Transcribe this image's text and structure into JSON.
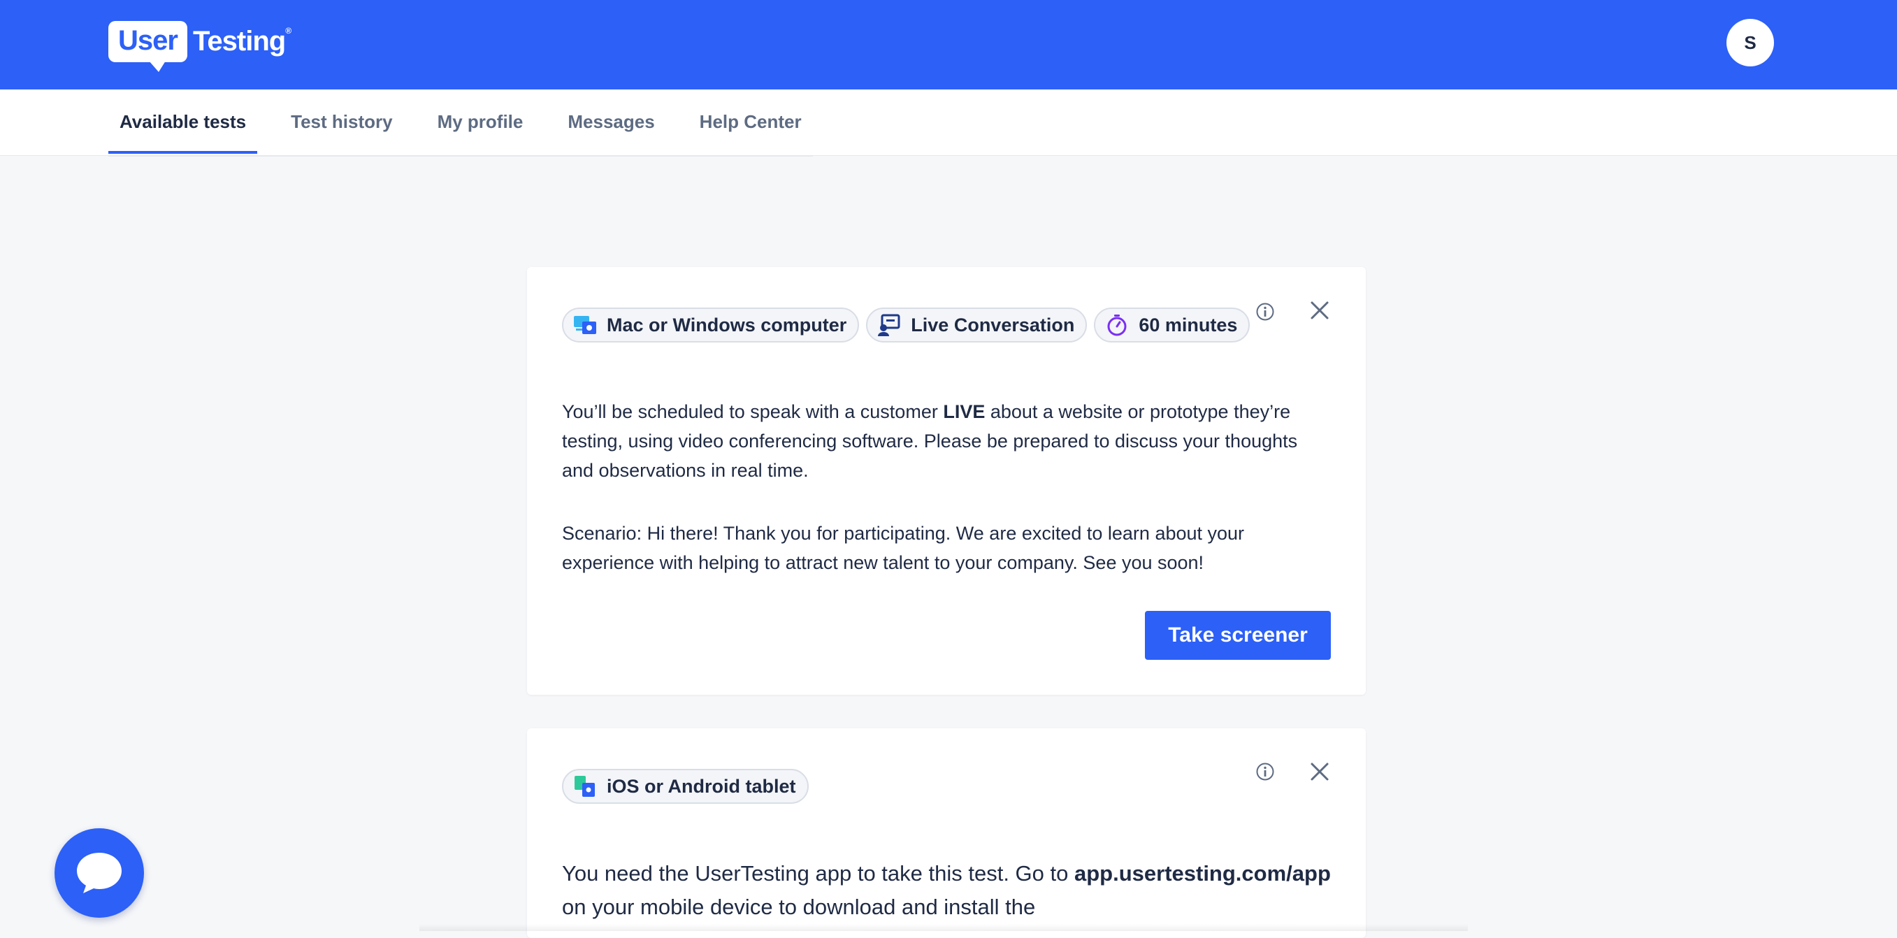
{
  "brand": {
    "logo_user": "User",
    "logo_testing": "Testing",
    "logo_reg": "®",
    "primary_color": "#2c60f7"
  },
  "account": {
    "avatar_initial": "S"
  },
  "nav": {
    "tabs": [
      {
        "label": "Available tests",
        "active": true
      },
      {
        "label": "Test history",
        "active": false
      },
      {
        "label": "My profile",
        "active": false
      },
      {
        "label": "Messages",
        "active": false
      },
      {
        "label": "Help Center",
        "active": false
      }
    ]
  },
  "tests": [
    {
      "tags": [
        {
          "icon": "desktop-devices-icon",
          "label": "Mac or Windows computer"
        },
        {
          "icon": "live-conversation-icon",
          "label": "Live Conversation"
        },
        {
          "icon": "stopwatch-icon",
          "label": "60 minutes"
        }
      ],
      "description_pre": "You’ll be scheduled to speak with a customer ",
      "description_bold": "LIVE",
      "description_post": " about a website or prototype they’re testing, using video conferencing software. Please be prepared to discuss your thoughts and observations in real time.",
      "scenario": "Scenario: Hi there! Thank you for participating. We are excited to learn about your experience with helping to attract new talent to your company. See you soon!",
      "cta_label": "Take screener"
    },
    {
      "tags": [
        {
          "icon": "tablet-devices-icon",
          "label": "iOS or Android tablet"
        }
      ],
      "description_pre": "You need the UserTesting app to take this test. Go to ",
      "description_bold": "app.usertesting.com/app",
      "description_post": " on your mobile device to download and install the"
    }
  ],
  "support": {
    "chat_icon": "chat-bubble-icon"
  }
}
